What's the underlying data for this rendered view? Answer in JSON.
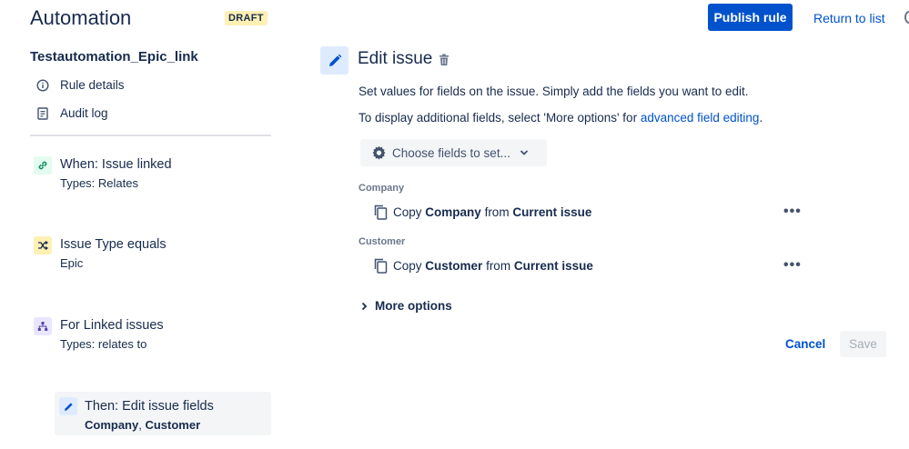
{
  "header": {
    "title": "Automation",
    "badge": "DRAFT",
    "publish_label": "Publish rule",
    "return_label": "Return to list"
  },
  "sidebar": {
    "rule_name": "Testautomation_Epic_link",
    "nav": [
      {
        "label": "Rule details",
        "icon": "info-icon"
      },
      {
        "label": "Audit log",
        "icon": "document-icon"
      }
    ],
    "steps": [
      {
        "title": "When: Issue linked",
        "sub": "Types: Relates",
        "icon": "link-icon",
        "color": "#e3fcef"
      },
      {
        "title": "Issue Type equals",
        "sub": "Epic",
        "icon": "shuffle-icon",
        "color": "#fff0b3"
      },
      {
        "title": "For Linked issues",
        "sub": "Types: relates to",
        "icon": "hierarchy-icon",
        "color": "#eae6ff"
      }
    ],
    "active_step": {
      "title": "Then: Edit issue fields",
      "sub_part1": "Company",
      "sub_sep": ", ",
      "sub_part2": "Customer",
      "icon": "pencil-icon"
    }
  },
  "main": {
    "title": "Edit issue",
    "desc1": "Set values for fields on the issue. Simply add the fields you want to edit.",
    "desc2_prefix": "To display additional fields, select 'More options' for ",
    "desc2_link": "advanced field editing",
    "desc2_suffix": ".",
    "choose_label": "Choose fields to set...",
    "fields": [
      {
        "label": "Company",
        "copy": "Copy",
        "field": "Company",
        "from": "from",
        "source": "Current issue"
      },
      {
        "label": "Customer",
        "copy": "Copy",
        "field": "Customer",
        "from": "from",
        "source": "Current issue"
      }
    ],
    "more_options": "More options",
    "cancel_label": "Cancel",
    "save_label": "Save"
  },
  "colors": {
    "primary": "#0052cc",
    "text": "#172b4d",
    "draft_bg": "#fff0b3"
  }
}
